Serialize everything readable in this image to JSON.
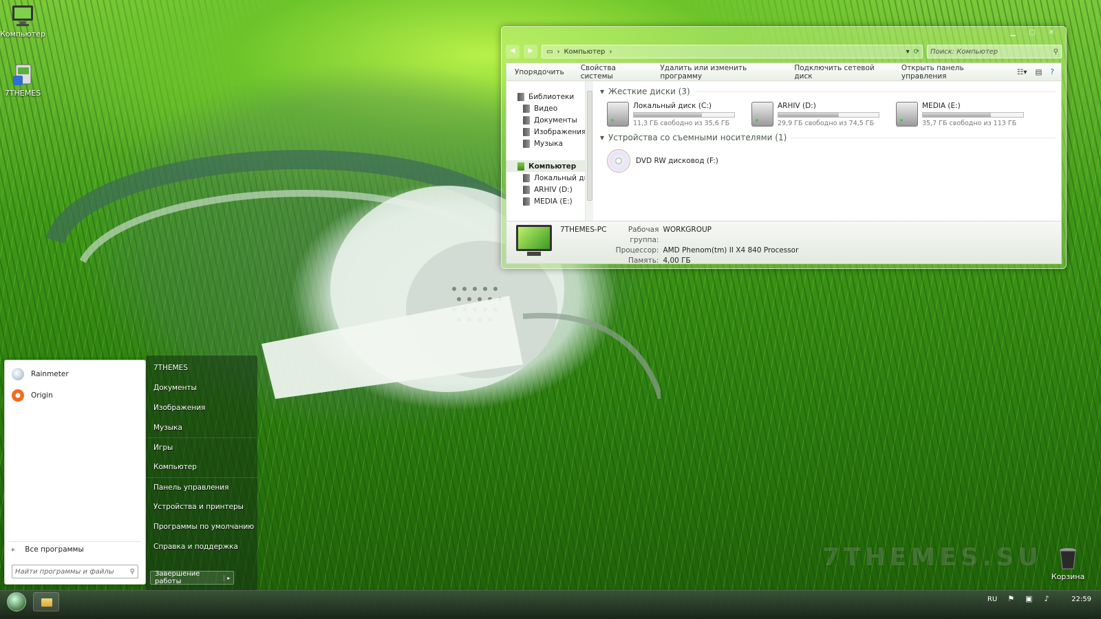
{
  "desktop": {
    "icons": [
      {
        "label": "Компьютер",
        "icon": "computer-icon"
      },
      {
        "label": "7THEMES",
        "icon": "installer-icon"
      }
    ],
    "recycle_bin": "Корзина",
    "watermark": "7THEMES.SU"
  },
  "explorer": {
    "address": "Компьютер",
    "search_placeholder": "Поиск: Компьютер",
    "toolbar": [
      "Упорядочить",
      "Свойства системы",
      "Удалить или изменить программу",
      "Подключить сетевой диск",
      "Открыть панель управления"
    ],
    "nav": {
      "libraries": "Библиотеки",
      "library_items": [
        "Видео",
        "Документы",
        "Изображения",
        "Музыка"
      ],
      "computer": "Компьютер",
      "computer_items": [
        "Локальный диск",
        "ARHIV (D:)",
        "MEDIA (E:)"
      ]
    },
    "hdd_group": "Жесткие диски (3)",
    "drives": [
      {
        "name": "Локальный диск (C:)",
        "free": "11,3 ГБ свободно из 35,6 ГБ",
        "used_fraction": 0.68
      },
      {
        "name": "ARHIV (D:)",
        "free": "29,9 ГБ свободно из 74,5 ГБ",
        "used_fraction": 0.6
      },
      {
        "name": "MEDIA (E:)",
        "free": "35,7 ГБ свободно из 113 ГБ",
        "used_fraction": 0.68
      }
    ],
    "removable_group": "Устройства со съемными носителями (1)",
    "dvd": "DVD RW дисковод (F:)",
    "details": {
      "pc_name": "7THEMES-PC",
      "workgroup_label": "Рабочая группа:",
      "workgroup": "WORKGROUP",
      "cpu_label": "Процессор:",
      "cpu": "AMD Phenom(tm) II X4 840 Processor",
      "ram_label": "Память:",
      "ram": "4,00 ГБ"
    }
  },
  "start_menu": {
    "programs": [
      {
        "label": "Rainmeter",
        "color": "#8fb0c8"
      },
      {
        "label": "Origin",
        "color": "#f26b1d"
      }
    ],
    "all_programs": "Все программы",
    "search_placeholder": "Найти программы и файлы",
    "right_items": [
      "7THEMES",
      "Документы",
      "Изображения",
      "Музыка",
      "Игры",
      "Компьютер",
      "Панель управления",
      "Устройства и принтеры",
      "Программы по умолчанию",
      "Справка и поддержка"
    ],
    "shutdown": "Завершение работы"
  },
  "taskbar": {
    "language": "RU",
    "time": "22:59"
  }
}
